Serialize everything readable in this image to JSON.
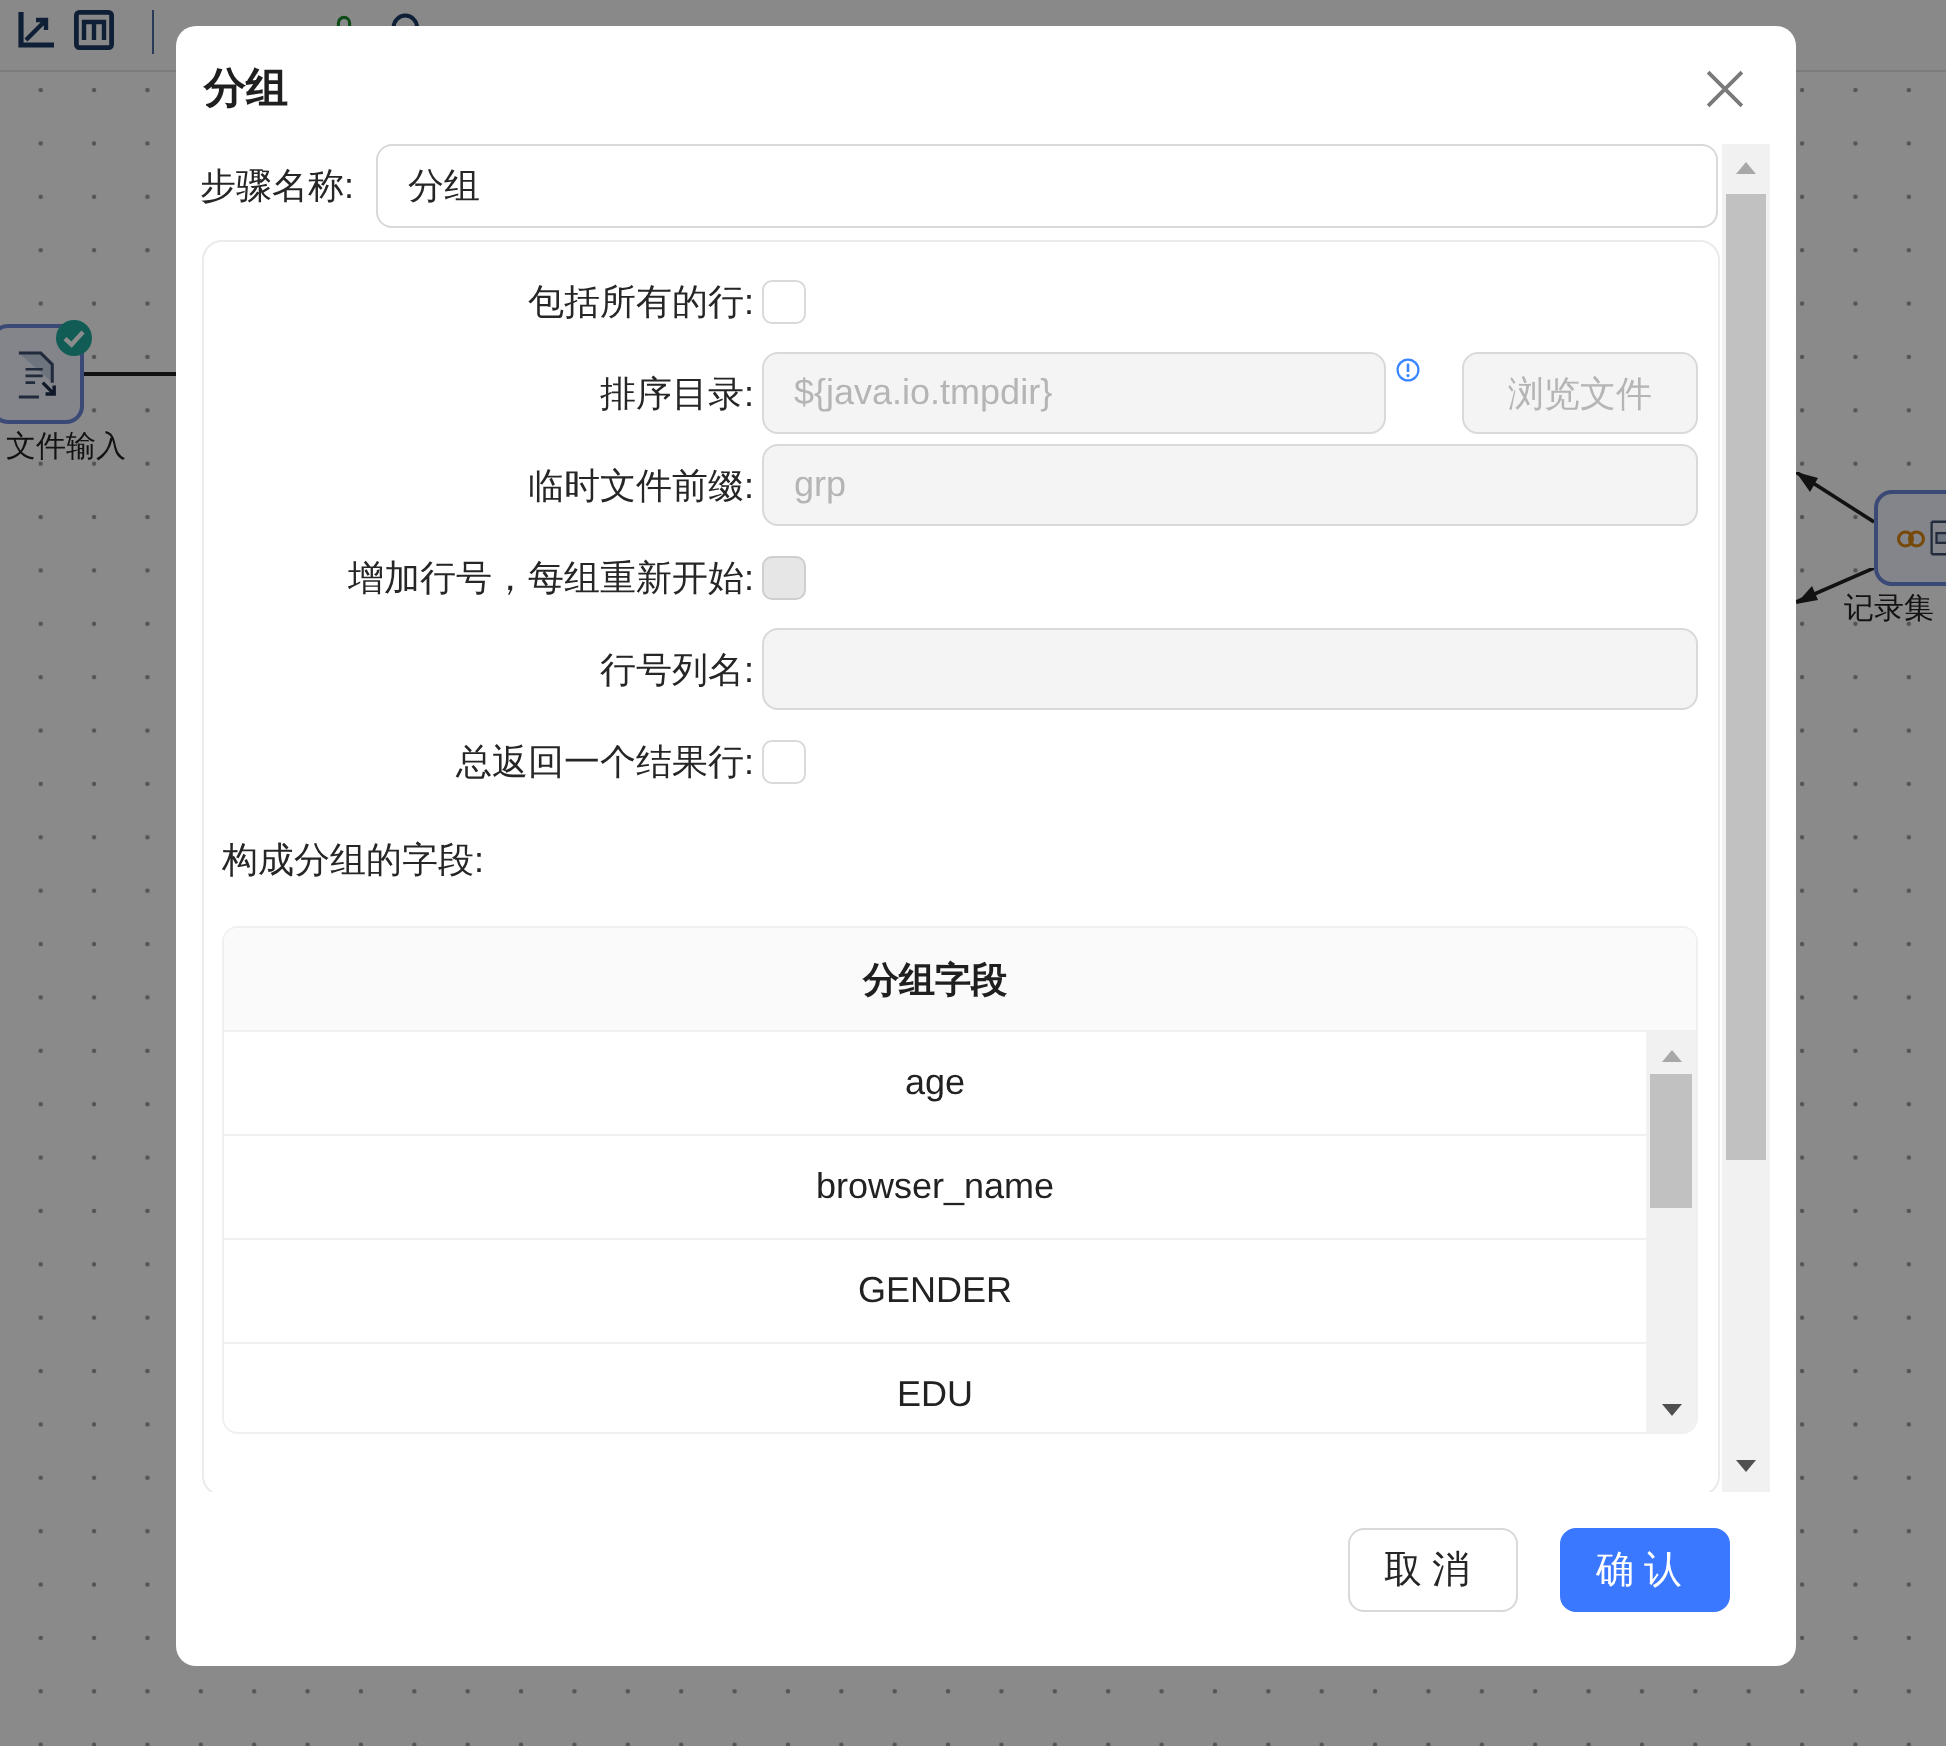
{
  "canvas": {
    "nodes": [
      {
        "kind": "file",
        "label": "文件输入",
        "done": true
      },
      {
        "kind": "merge",
        "label": "记录集"
      }
    ]
  },
  "dialog": {
    "title": "分组",
    "step_name": {
      "label": "步骤名称:",
      "value": "分组"
    },
    "options": [
      {
        "kind": "checkbox",
        "label": "包括所有的行:",
        "checked": false,
        "disabled": false
      },
      {
        "kind": "path",
        "label": "排序目录:",
        "value": "${java.io.tmpdir}",
        "disabled": true,
        "button": {
          "label": "浏览文件",
          "disabled": true
        }
      },
      {
        "kind": "text",
        "label": "临时文件前缀:",
        "value": "grp",
        "disabled": true
      },
      {
        "kind": "checkbox",
        "label": "增加行号，每组重新开始:",
        "checked": false,
        "disabled": true
      },
      {
        "kind": "text",
        "label": "行号列名:",
        "disabled": true
      },
      {
        "kind": "checkbox",
        "label": "总返回一个结果行:",
        "checked": false,
        "disabled": false
      }
    ],
    "fields_section": {
      "label": "构成分组的字段:",
      "table": {
        "columns": [
          "分组字段"
        ],
        "rows": [
          [
            "age"
          ],
          [
            "browser_name"
          ],
          [
            "GENDER"
          ],
          [
            "EDU"
          ]
        ]
      }
    },
    "buttons": [
      {
        "kind": "default",
        "label": "取消"
      },
      {
        "kind": "primary",
        "label": "确认"
      }
    ]
  }
}
